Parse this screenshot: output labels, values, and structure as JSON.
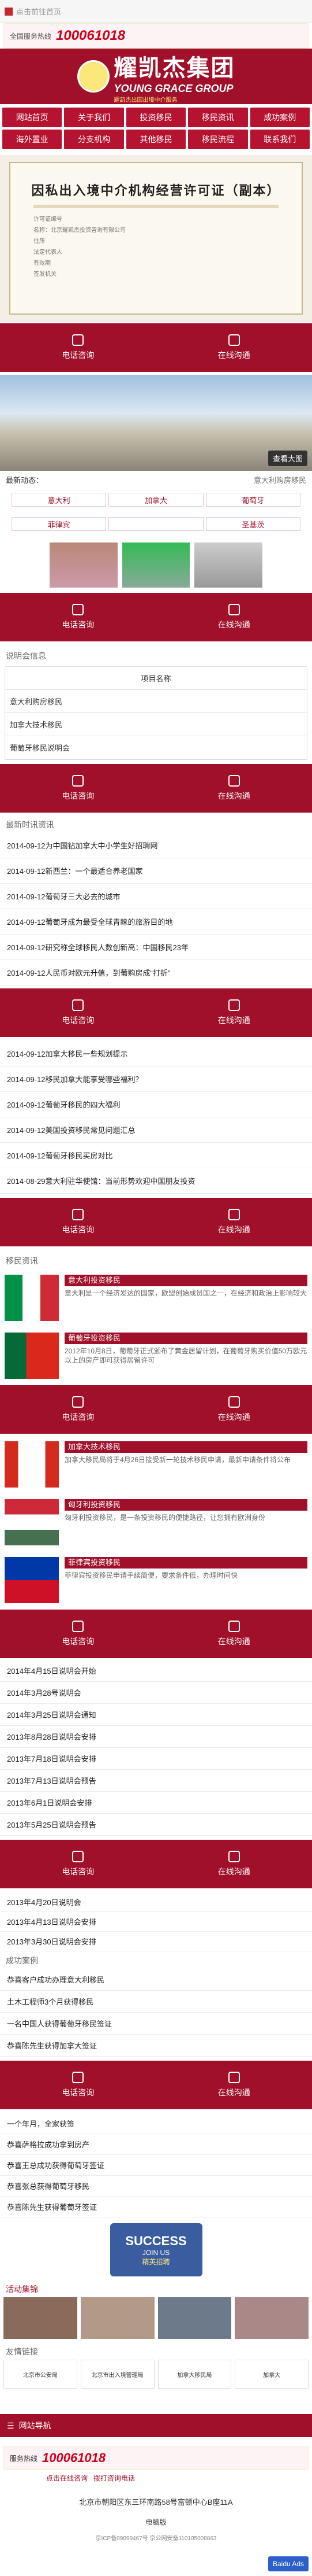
{
  "topbar": {
    "text": "点击前往首页"
  },
  "hotline": {
    "label": "全国服务热线",
    "number": "100061018"
  },
  "logo": {
    "cn": "耀凯杰集团",
    "en": "YOUNG GRACE GROUP",
    "sub": "耀凯杰出国出境中介服务"
  },
  "nav": [
    "网站首页",
    "关于我们",
    "投资移民",
    "移民资讯",
    "成功案例",
    "海外置业",
    "分支机构",
    "其他移民",
    "移民流程",
    "联系我们"
  ],
  "licence": {
    "title": "因私出入境中介机构经营许可证（副本）",
    "lines": [
      "许可证编号",
      "名称：北京耀凯杰投资咨询有限公司",
      "住所",
      "法定代表人",
      "有效期",
      "签发机关"
    ]
  },
  "callbar": {
    "left": "电话咨询",
    "right": "在线沟通"
  },
  "tour": {
    "zoom": "查看大图"
  },
  "latest": {
    "label": "最新动态：",
    "more": "意大利购房移民"
  },
  "tags": [
    "意大利",
    "加拿大",
    "葡萄牙",
    "菲律宾",
    "",
    "圣基茨"
  ],
  "sections": {
    "info_table": "说明会信息",
    "news": "最新时讯资讯",
    "immigration": "移民资讯",
    "success": "成功案例",
    "partners": "友情链接"
  },
  "info_rows": [
    "项目名称",
    "意大利购房移民",
    "加拿大技术移民",
    "葡萄牙移民说明会"
  ],
  "news_rows": [
    "2014-09-12为中国钻加拿大中小学生好招聘网",
    "2014-09-12新西兰：一个最适合养老国家",
    "2014-09-12葡萄牙三大必去的城市",
    "2014-09-12葡萄牙成为最受全球青睐的旅游目的地",
    "2014-09-12研究称全球移民人数创新高：中国移民23年",
    "2014-09-12人民币对欧元升值，到葡购房成“打折”"
  ],
  "news_rows2": [
    "2014-09-12加拿大移民一些规划提示",
    "2014-09-12移民加拿大能享受哪些福利？",
    "2014-09-12葡萄牙移民的四大福利",
    "2014-09-12美国投资移民常见问题汇总",
    "2014-09-12葡萄牙移民买房对比",
    "2014-08-29意大利驻华使馆：当前形势欢迎中国朋友投资"
  ],
  "countries": [
    {
      "title": "意大利投资移民",
      "desc": "意大利是一个经济发达的国家，欧盟创始成员国之一，在经济和政治上影响较大"
    },
    {
      "title": "葡萄牙投资移民",
      "desc": "2012年10月8日，葡萄牙正式颁布了黄金居留计划，在葡萄牙购买价值50万欧元以上的房产即可获得居留许可"
    },
    {
      "title": "加拿大技术移民",
      "desc": "加拿大移民局将于4月26日接受新一轮技术移民申请，最新申请条件将公布"
    },
    {
      "title": "匈牙利投资移民",
      "desc": "匈牙利投资移民，是一条投资移民的便捷路径，让您拥有欧洲身份"
    },
    {
      "title": "菲律宾投资移民",
      "desc": "菲律宾投资移民申请手续简便，要求条件低，办理时间快"
    }
  ],
  "dated_rows": [
    "2014年4月15日说明会开始",
    "2014年3月28号说明会",
    "2014年3月25日说明会通知",
    "2013年8月28日说明会安排",
    "2013年7月18日说明会安排",
    "2013年7月13日说明会预告",
    "2013年6月1日说明会安排",
    "2013年5月25日说明会预告"
  ],
  "dated_rows2": [
    "2013年4月20日说明会",
    "2013年4月13日说明会安排",
    "2013年3月30日说明会安排"
  ],
  "success_rows": [
    "恭喜客户成功办理意大利移民",
    "土木工程师3个月获得移民",
    "一名中国人获得葡萄牙移民签证",
    "恭喜陈先生获得加拿大签证"
  ],
  "success_rows2": [
    "一个年月，全家获签",
    "恭喜萨格拉成功拿到房产",
    "恭喜王总成功获得葡萄牙签证",
    "恭喜张总获得葡萄牙移民",
    "恭喜陈先生获得葡萄牙签证"
  ],
  "join": {
    "big": "SUCCESS",
    "sub": "JOIN US",
    "cn": "精英招聘"
  },
  "gallery_title": "活动集锦",
  "partners": [
    "北京市公安局",
    "北京市出入境管理局",
    "加拿大移民局",
    "加拿大"
  ],
  "footer": {
    "nav": "网站导航",
    "hotline_label": "服务热线",
    "number": "100061018",
    "link1": "点击在线咨询",
    "link2": "拨打咨询电话",
    "addr": "北京市朝阳区东三环南路58号富顿中心B座11A",
    "logo": "电脑版",
    "tiny": "京ICP备09099467号 京公网安备110105008863",
    "baidu": "Baidu Ads"
  }
}
